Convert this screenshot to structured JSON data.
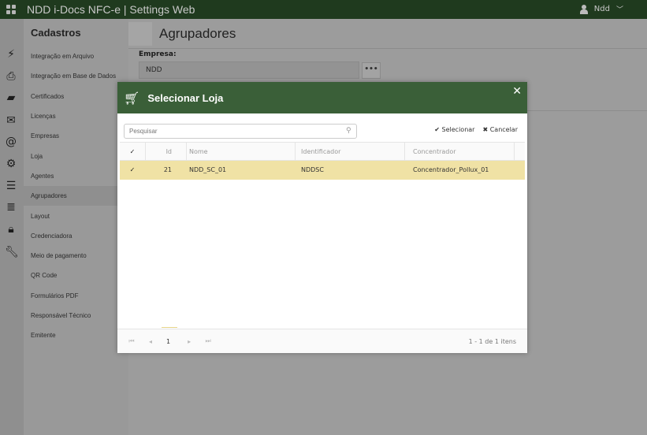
{
  "app": {
    "title": "NDD i-Docs NFC-e | Settings Web",
    "user": "Ndd"
  },
  "iconbar": [
    "plug-icon",
    "printer-icon",
    "folder-open-icon",
    "envelope-icon",
    "at-icon",
    "gear-icon",
    "sliders-icon",
    "server-icon",
    "lock-icon",
    "wrench-icon"
  ],
  "sidebar": {
    "title": "Cadastros",
    "items": [
      "Integração em Arquivo",
      "Integração em Base de Dados",
      "Certificados",
      "Licenças",
      "Empresas",
      "Loja",
      "Agentes",
      "Agrupadores",
      "Layout",
      "Credenciadora",
      "Meio de pagamento",
      "QR Code",
      "Formulários PDF",
      "Responsável Técnico",
      "Emitente"
    ],
    "active": "Agrupadores"
  },
  "page": {
    "title": "Agrupadores",
    "empresa_label": "Empresa:",
    "empresa_value": "NDD",
    "lookup_label": "•••"
  },
  "modal": {
    "title": "Selecionar Loja",
    "close": "✕",
    "search_placeholder": "Pesquisar",
    "select_label": "Selecionar",
    "cancel_label": "Cancelar",
    "columns": [
      "Id",
      "Nome",
      "Identificador",
      "Concentrador"
    ],
    "rows": [
      {
        "checked": "✓",
        "id": "21",
        "nome": "NDD_SC_01",
        "identificador": "NDDSC",
        "concentrador": "Concentrador_Pollux_01"
      }
    ],
    "pager": {
      "page": "1",
      "info": "1 - 1 de 1 itens"
    },
    "colors": {
      "header": "#3a5f38",
      "selected_row": "#f0e2a5"
    }
  }
}
